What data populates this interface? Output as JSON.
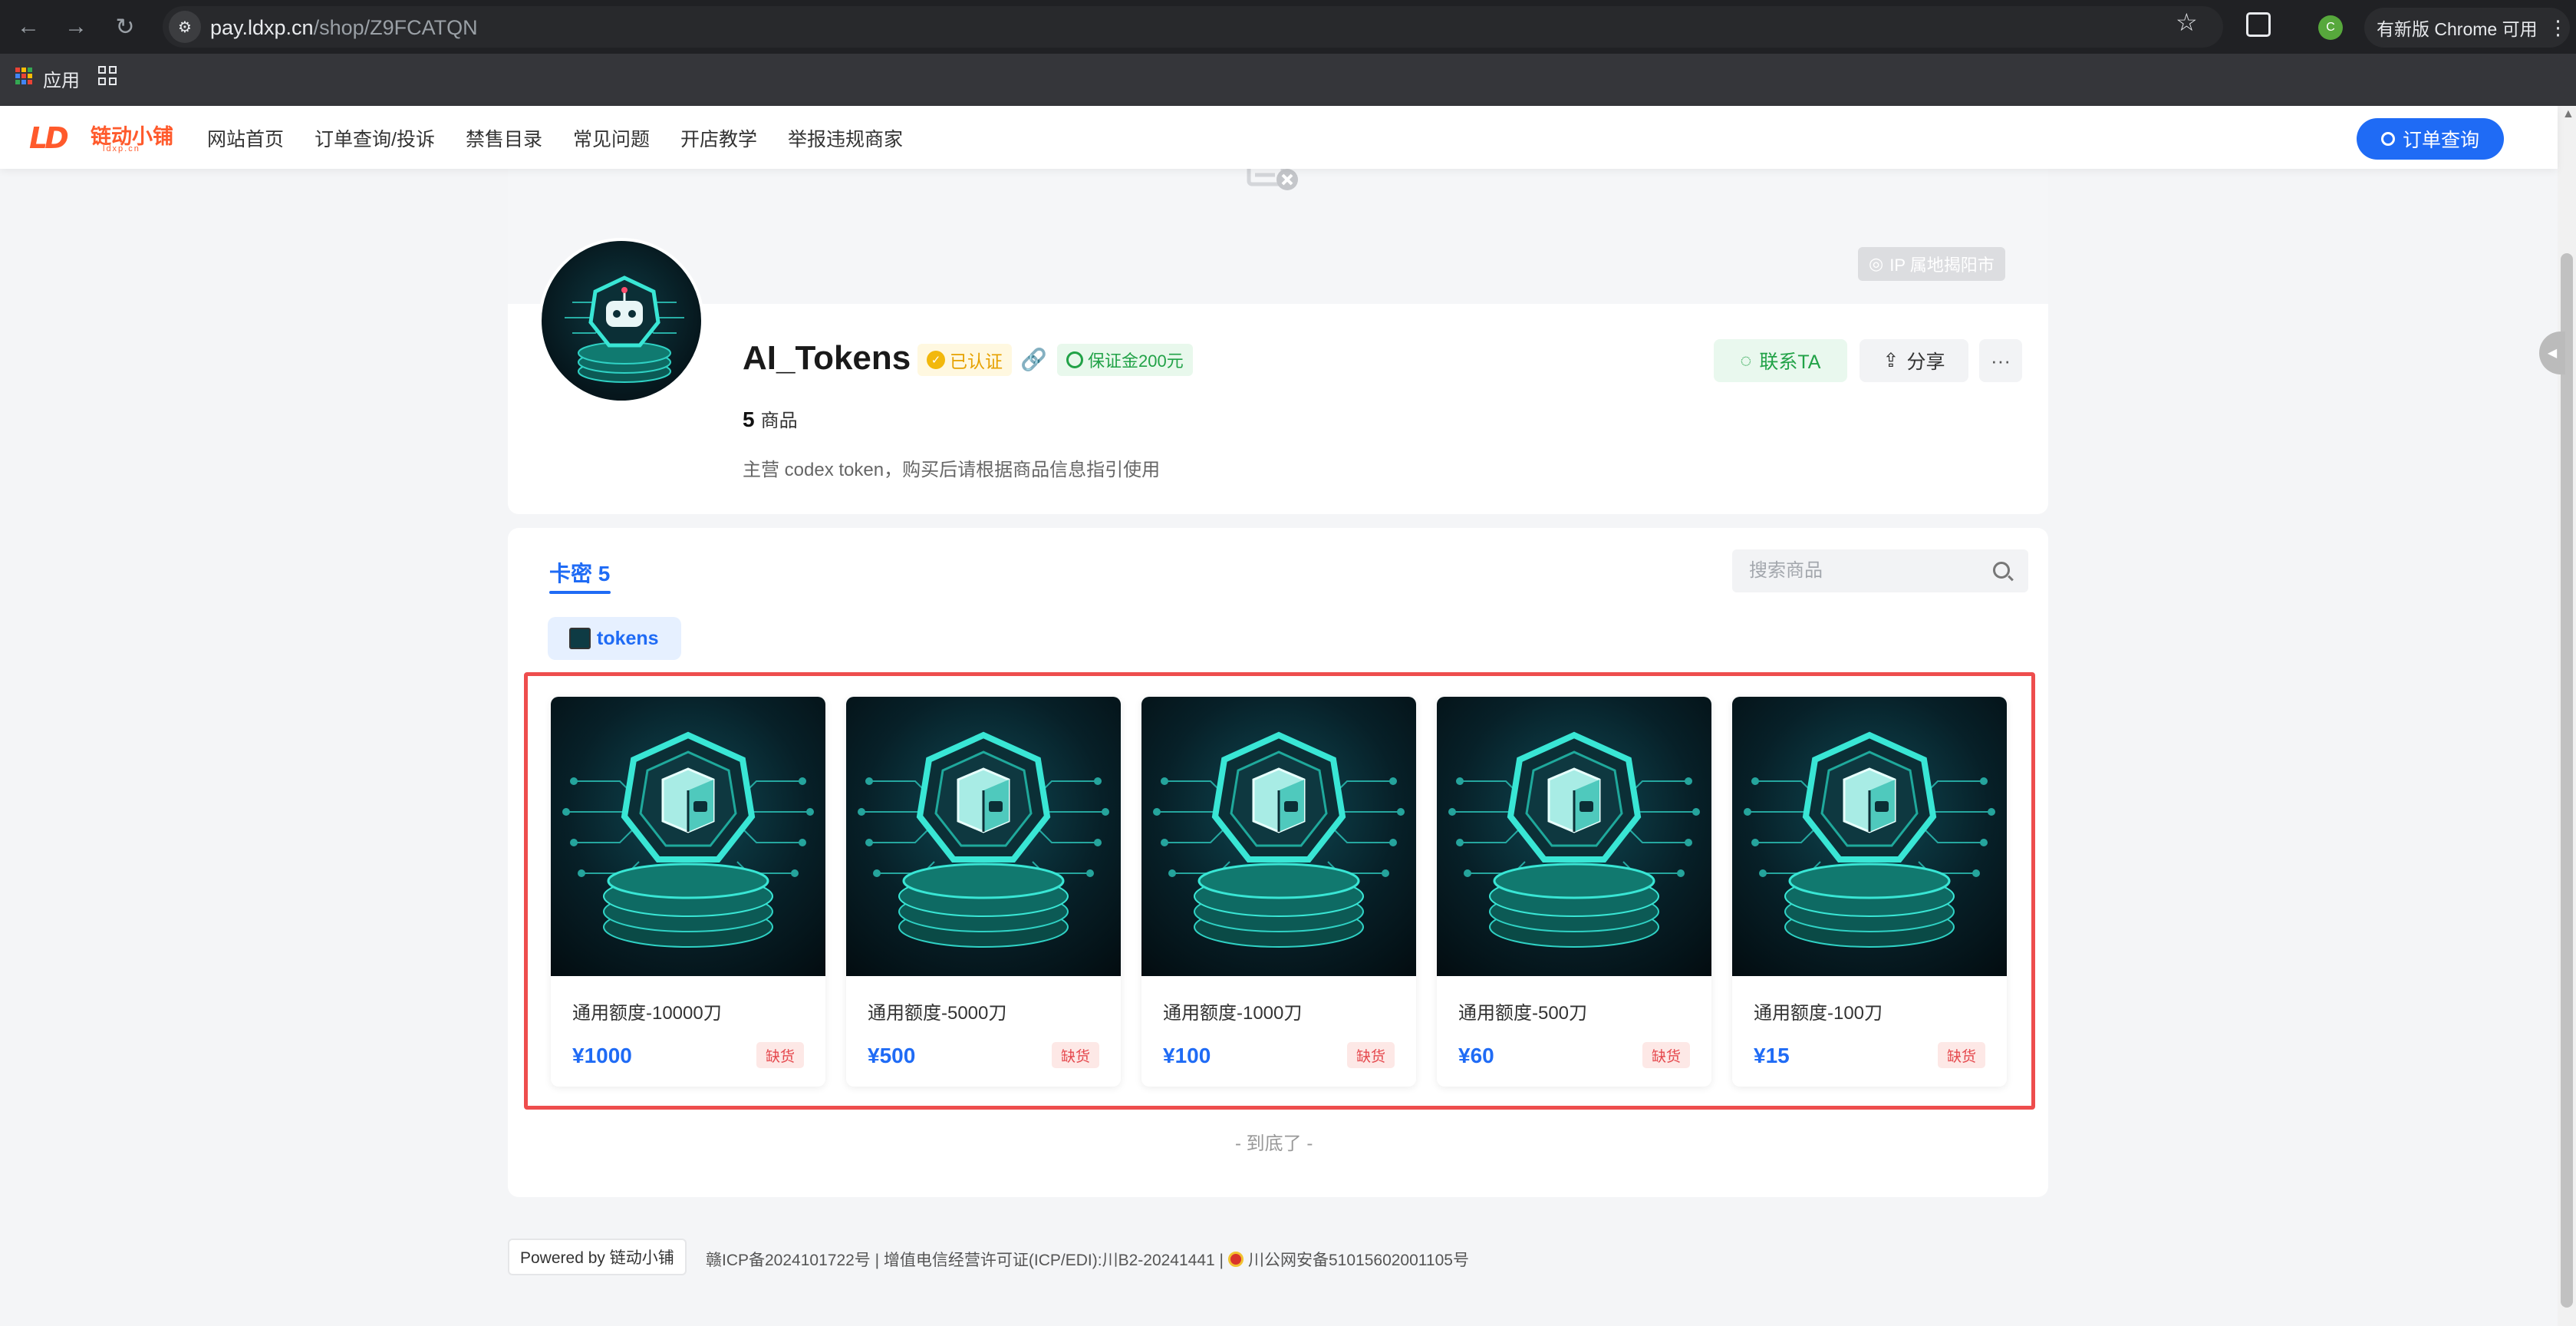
{
  "browser": {
    "url_host": "pay.ldxp.cn",
    "url_path": "/shop/Z9FCATQN",
    "profile_initial": "C",
    "update_label": "有新版 Chrome 可用",
    "bookmarks": {
      "apps_label": "应用"
    }
  },
  "site": {
    "logo_text": "链动小铺",
    "logo_sub": "ldxp.cn",
    "nav": [
      "网站首页",
      "订单查询/投诉",
      "禁售目录",
      "常见问题",
      "开店教学",
      "举报违规商家"
    ],
    "order_query_label": "订单查询"
  },
  "shop": {
    "ip_location": "IP 属地揭阳市",
    "name": "AI_Tokens",
    "verified_label": "已认证",
    "deposit_label": "保证金200元",
    "goods_count": "5",
    "goods_count_label": "商品",
    "description": "主营 codex token，购买后请根据商品信息指引使用",
    "contact_label": "联系TA",
    "share_label": "分享",
    "more_label": "···"
  },
  "catalog": {
    "tab_label": "卡密 5",
    "search_placeholder": "搜索商品",
    "category_chip": "tokens",
    "products": [
      {
        "name": "通用额度-10000刀",
        "price": "¥1000",
        "badge": "缺货"
      },
      {
        "name": "通用额度-5000刀",
        "price": "¥500",
        "badge": "缺货"
      },
      {
        "name": "通用额度-1000刀",
        "price": "¥100",
        "badge": "缺货"
      },
      {
        "name": "通用额度-500刀",
        "price": "¥60",
        "badge": "缺货"
      },
      {
        "name": "通用额度-100刀",
        "price": "¥15",
        "badge": "缺货"
      }
    ],
    "end_label": "- 到底了 -"
  },
  "footer": {
    "powered_by": "Powered by 链动小铺",
    "icp_text": "赣ICP备2024101722号 | 增值电信经营许可证(ICP/EDI):川B2-20241441 |",
    "police_text": "川公网安备51015602001105号"
  },
  "colors": {
    "accent": "#1f6bf5",
    "brand": "#ff5a2c",
    "highlight": "#ee4d4d",
    "success": "#21a247"
  }
}
